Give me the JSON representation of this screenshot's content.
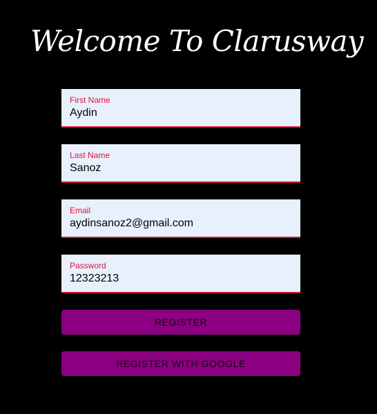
{
  "header": {
    "title": "Welcome To Clarusway"
  },
  "form": {
    "first_name": {
      "label": "First Name",
      "value": "Aydin"
    },
    "last_name": {
      "label": "Last Name",
      "value": "Sanoz"
    },
    "email": {
      "label": "Email",
      "value": "aydinsanoz2@gmail.com"
    },
    "password": {
      "label": "Password",
      "value": "12323213"
    }
  },
  "actions": {
    "register_label": "REGISTER",
    "register_google_label": "REGISTER WITH GOOGLE"
  },
  "colors": {
    "background": "#000000",
    "title": "#ffffff",
    "field_background": "#e8f0fe",
    "label_accent": "#dc143c",
    "button": "#8b0081"
  }
}
